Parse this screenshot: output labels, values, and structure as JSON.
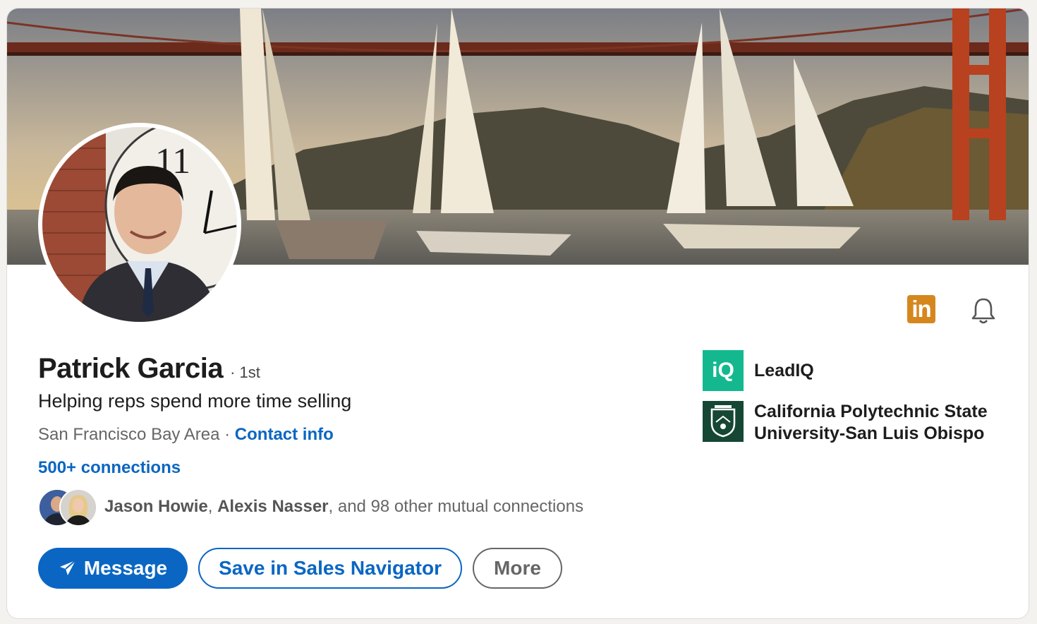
{
  "profile": {
    "name": "Patrick Garcia",
    "degree": "· 1st",
    "headline": "Helping reps spend more time selling",
    "location": "San Francisco Bay Area",
    "separator": " · ",
    "contact_info": "Contact info",
    "connections": "500+ connections"
  },
  "mutual": {
    "name1": "Jason Howie",
    "comma": ", ",
    "name2": "Alexis Nasser",
    "rest": ", and 98 other mutual connections"
  },
  "actions": {
    "message": "Message",
    "save": "Save in Sales Navigator",
    "more": "More"
  },
  "orgs": {
    "company": "LeadIQ",
    "company_logo": "iQ",
    "school": "California Polytechnic State University-San Luis Obispo"
  },
  "icons": {
    "linkedin": "in",
    "bell": "bell-icon",
    "send": "paper-plane-icon"
  },
  "colors": {
    "accent": "#0a66c2",
    "linkedin_badge": "#d5871e",
    "leadiq": "#14b88f",
    "calpoly": "#154734"
  }
}
